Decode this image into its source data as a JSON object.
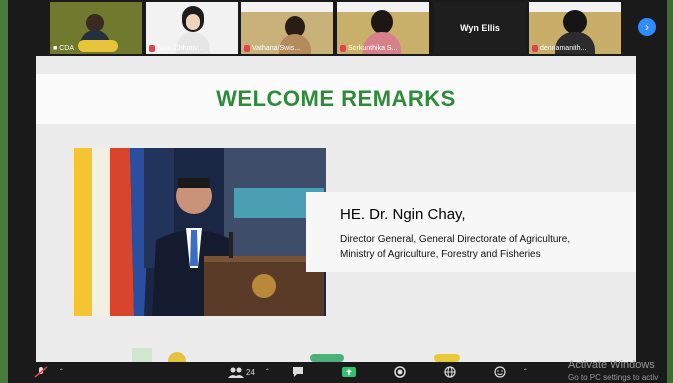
{
  "participants": [
    {
      "name": "CDA",
      "muted": false
    },
    {
      "name": "Sorn Chhoriv...",
      "muted": true
    },
    {
      "name": "Vathana/Swis...",
      "muted": true
    },
    {
      "name": "Sorkunthika S...",
      "muted": true
    },
    {
      "name": "Wyn Ellis",
      "muted": false
    },
    {
      "name": "dennamanith...",
      "muted": true
    }
  ],
  "slide": {
    "title": "WELCOME REMARKS",
    "speaker_name": "HE. Dr. Ngin Chay,",
    "speaker_role_line1": "Director General, General Directorate of Agriculture,",
    "speaker_role_line2": "Ministry of Agriculture, Forestry and Fisheries"
  },
  "toolbar": {
    "participant_count": "24"
  },
  "watermark": {
    "line1": "Activate Windows",
    "line2": "Go to PC settings to activ"
  },
  "colors": {
    "title_green": "#2e8b3a",
    "next_button": "#2d8cff",
    "muted_red": "#e0454b"
  }
}
